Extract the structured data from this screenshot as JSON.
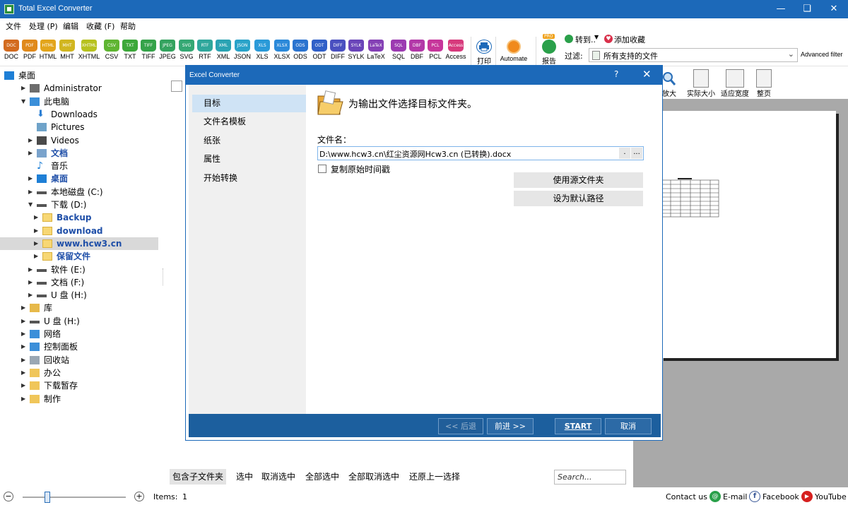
{
  "app": {
    "title": "Total Excel Converter"
  },
  "menu": [
    "文件",
    "处理 (P)",
    "编辑",
    "收藏 (F)",
    "帮助"
  ],
  "formats": [
    {
      "icon": "DOC",
      "label": "DOC",
      "color": "#d36b1f"
    },
    {
      "icon": "PDF",
      "label": "PDF",
      "color": "#e08a1c"
    },
    {
      "icon": "HTML",
      "label": "HTML",
      "color": "#e3a51b"
    },
    {
      "icon": "MHT",
      "label": "MHT",
      "color": "#d1b620"
    },
    {
      "icon": "XHTML",
      "label": "XHTML",
      "color": "#b7c21f"
    },
    {
      "icon": "CSV",
      "label": "CSV",
      "color": "#5fb532"
    },
    {
      "icon": "TXT",
      "label": "TXT",
      "color": "#3da83a"
    },
    {
      "icon": "TIFF",
      "label": "TIFF",
      "color": "#35a34a"
    },
    {
      "icon": "JPEG",
      "label": "JPEG",
      "color": "#34a35f"
    },
    {
      "icon": "SVG",
      "label": "SVG",
      "color": "#35a874"
    },
    {
      "icon": "RTF",
      "label": "RTF",
      "color": "#2fa79c"
    },
    {
      "icon": "XML",
      "label": "XML",
      "color": "#2aa3b3"
    },
    {
      "icon": "JSON",
      "label": "JSON",
      "color": "#2aa3c9"
    },
    {
      "icon": "XLS",
      "label": "XLS",
      "color": "#2a9ad8"
    },
    {
      "icon": "XLSX",
      "label": "XLSX",
      "color": "#2b89d9"
    },
    {
      "icon": "ODS",
      "label": "ODS",
      "color": "#2c74cf"
    },
    {
      "icon": "ODT",
      "label": "ODT",
      "color": "#3160c8"
    },
    {
      "icon": "DIFF",
      "label": "DIFF",
      "color": "#4a50c0"
    },
    {
      "icon": "SYLK",
      "label": "SYLK",
      "color": "#6a45b9"
    },
    {
      "icon": "LaTeX",
      "label": "LaTeX",
      "color": "#8440b5"
    },
    {
      "icon": "SQL",
      "label": "SQL",
      "color": "#9c3bb1"
    },
    {
      "icon": "DBF",
      "label": "DBF",
      "color": "#b338a8"
    },
    {
      "icon": "PCL",
      "label": "PCL",
      "color": "#c7369b"
    },
    {
      "icon": "Access",
      "label": "Access",
      "color": "#d73a7c"
    }
  ],
  "toolbar": {
    "print": "打印",
    "automate": "Automate",
    "report": "报告",
    "pro_badge": "PRO",
    "goto": "转到..",
    "add_fav": "添加收藏",
    "filter_label": "过滤:",
    "filter_value": "所有支持的文件",
    "advanced_filter": "Advanced filter"
  },
  "tree": [
    {
      "label": "桌面",
      "level": 0,
      "arrow": "",
      "icon": "desktop-icon",
      "color": "#1e7fd6"
    },
    {
      "label": "Administrator",
      "level": 1,
      "arrow": "▶",
      "icon": "user-icon",
      "color": "#6d6d6d"
    },
    {
      "label": "此电脑",
      "level": 1,
      "arrow": "▼",
      "icon": "computer-icon",
      "color": "#3b8fd9"
    },
    {
      "label": "Downloads",
      "level": 2,
      "arrow": "",
      "icon": "download-arrow-icon",
      "color": "#2a7ed3"
    },
    {
      "label": "Pictures",
      "level": 2,
      "arrow": "",
      "icon": "picture-icon",
      "color": "#6fa3c9"
    },
    {
      "label": "Videos",
      "level": 2,
      "arrow": "▶",
      "icon": "video-icon",
      "color": "#4a4a4a"
    },
    {
      "label": "文档",
      "level": 2,
      "arrow": "▶",
      "icon": "document-icon",
      "color": "#7aa3cc",
      "blue": true
    },
    {
      "label": "音乐",
      "level": 2,
      "arrow": "",
      "icon": "music-icon",
      "color": "#1e7fd6"
    },
    {
      "label": "桌面",
      "level": 2,
      "arrow": "▶",
      "icon": "desktop-icon",
      "color": "#1e7fd6",
      "blue": true
    },
    {
      "label": "本地磁盘 (C:)",
      "level": 2,
      "arrow": "▶",
      "icon": "drive-icon",
      "color": "#555"
    },
    {
      "label": "下载 (D:)",
      "level": 2,
      "arrow": "▼",
      "icon": "drive-icon",
      "color": "#555"
    },
    {
      "label": "Backup",
      "level": 3,
      "arrow": "▶",
      "icon": "folder-icon",
      "color": "#f7d774",
      "blue": true
    },
    {
      "label": "download",
      "level": 3,
      "arrow": "▶",
      "icon": "folder-icon",
      "color": "#f7d774",
      "blue": true
    },
    {
      "label": "www.hcw3.cn",
      "level": 3,
      "arrow": "▶",
      "icon": "folder-icon",
      "color": "#f7d774",
      "blue": true,
      "selected": true
    },
    {
      "label": "保留文件",
      "level": 3,
      "arrow": "▶",
      "icon": "folder-icon",
      "color": "#f7d774",
      "blue": true
    },
    {
      "label": "软件 (E:)",
      "level": 2,
      "arrow": "▶",
      "icon": "drive-icon",
      "color": "#555"
    },
    {
      "label": "文档 (F:)",
      "level": 2,
      "arrow": "▶",
      "icon": "drive-icon",
      "color": "#555"
    },
    {
      "label": "U 盘 (H:)",
      "level": 2,
      "arrow": "▶",
      "icon": "usb-drive-icon",
      "color": "#555"
    },
    {
      "label": "库",
      "level": 1,
      "arrow": "▶",
      "icon": "library-icon",
      "color": "#e7b94a"
    },
    {
      "label": "U 盘 (H:)",
      "level": 1,
      "arrow": "▶",
      "icon": "usb-drive-icon",
      "color": "#555"
    },
    {
      "label": "网络",
      "level": 1,
      "arrow": "▶",
      "icon": "network-icon",
      "color": "#3b8fd9"
    },
    {
      "label": "控制面板",
      "level": 1,
      "arrow": "▶",
      "icon": "control-panel-icon",
      "color": "#3b8fd9"
    },
    {
      "label": "回收站",
      "level": 1,
      "arrow": "▶",
      "icon": "recycle-bin-icon",
      "color": "#9aa7b3"
    },
    {
      "label": "办公",
      "level": 1,
      "arrow": "▶",
      "icon": "shortcut-folder-icon",
      "color": "#f0c65a"
    },
    {
      "label": "下载暂存",
      "level": 1,
      "arrow": "▶",
      "icon": "shortcut-folder-icon",
      "color": "#f0c65a"
    },
    {
      "label": "制作",
      "level": 1,
      "arrow": "▶",
      "icon": "shortcut-folder-icon",
      "color": "#f0c65a"
    }
  ],
  "zoom_toolbar": {
    "zoom_in": "放大",
    "actual_size": "实际大小",
    "fit_width": "适应宽度",
    "whole_page": "整页"
  },
  "dialog": {
    "title": "Excel Converter",
    "help": "?",
    "close": "✕",
    "nav": [
      "目标",
      "文件名模板",
      "纸张",
      "属性",
      "开始转换"
    ],
    "heading": "为输出文件选择目标文件夹。",
    "filename_label": "文件名：",
    "filename_value": "D:\\www.hcw3.cn\\红尘资源网Hcw3.cn (已转换).docx",
    "dot_btn": ".",
    "browse_btn": "...",
    "copy_time_label": "复制原始时间戳",
    "use_source_folder": "使用源文件夹",
    "set_default_path": "设为默认路径",
    "back": "<< 后退",
    "next": "前进 >>",
    "start": "START",
    "cancel": "取消"
  },
  "bottom": {
    "include_sub": "包含子文件夹",
    "select": "选中",
    "deselect": "取消选中",
    "select_all": "全部选中",
    "deselect_all": "全部取消选中",
    "restore": "还原上一选择",
    "search_placeholder": "Search..."
  },
  "status": {
    "items_label": "Items:",
    "items_count": "1",
    "contact": "Contact us",
    "email": "E-mail",
    "facebook": "Facebook",
    "youtube": "YouTube"
  }
}
